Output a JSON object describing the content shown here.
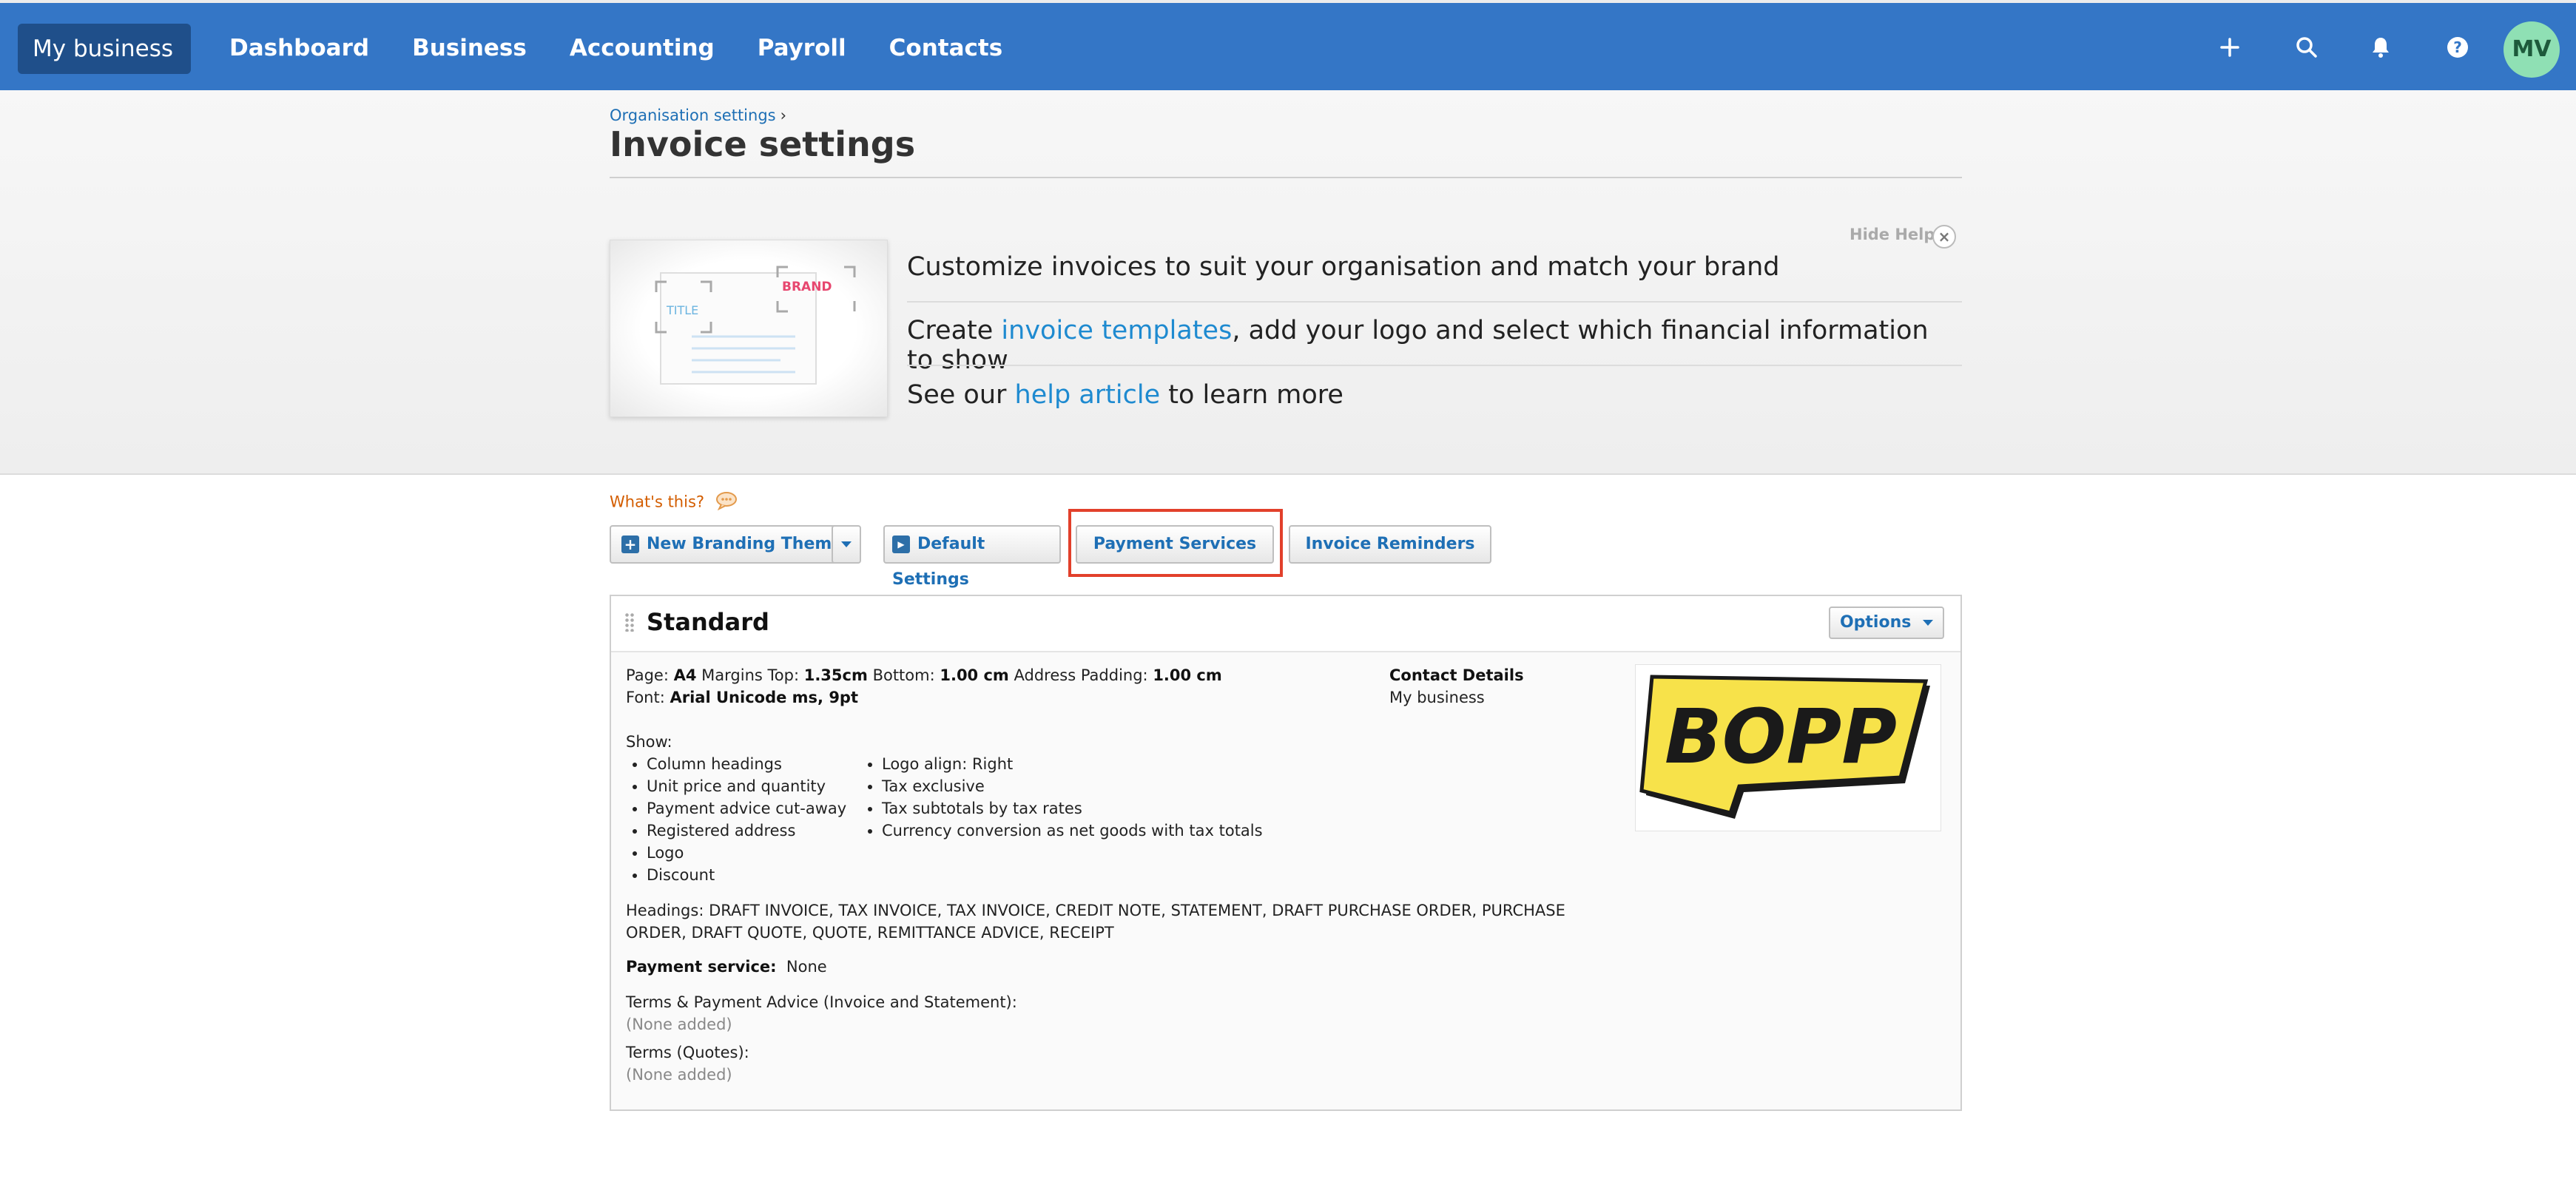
{
  "nav": {
    "business_switcher": "My business",
    "links": [
      "Dashboard",
      "Business",
      "Accounting",
      "Payroll",
      "Contacts"
    ],
    "icons": [
      "plus-icon",
      "search-icon",
      "bell-icon",
      "help-icon"
    ],
    "avatar_initials": "MV",
    "color": "#3476c6"
  },
  "breadcrumb": {
    "parent": "Organisation settings",
    "separator": "›"
  },
  "page_title": "Invoice settings",
  "help": {
    "hide_label": "Hide Help",
    "thumb_title": "TITLE",
    "thumb_brand": "BRAND",
    "line1": "Customize invoices to suit your organisation and match your brand",
    "line2_pre": "Create ",
    "line2_link": "invoice templates",
    "line2_post": ", add your logo and select which financial information to show",
    "line3_pre": "See our ",
    "line3_link": "help article",
    "line3_post": " to learn more"
  },
  "toolbar": {
    "whats_this": "What's this?",
    "new_theme": "New Branding Theme",
    "default_settings": "Default Settings",
    "payment_services": "Payment Services",
    "invoice_reminders": "Invoice Reminders"
  },
  "theme": {
    "name": "Standard",
    "options_label": "Options",
    "page_label": "Page:",
    "page_value": "A4",
    "margins_top_label": "Margins Top:",
    "margins_top_value": "1.35cm",
    "bottom_label": "Bottom:",
    "bottom_value": "1.00 cm",
    "address_padding_label": "Address Padding:",
    "address_padding_value": "1.00 cm",
    "font_label": "Font:",
    "font_value": "Arial Unicode ms, 9pt",
    "show_label": "Show:",
    "show_col1": [
      "Column headings",
      "Unit price and quantity",
      "Payment advice cut-away",
      "Registered address",
      "Logo",
      "Discount"
    ],
    "show_col2": [
      "Logo align: Right",
      "Tax exclusive",
      "Tax subtotals by tax rates",
      "Currency conversion as net goods with tax totals"
    ],
    "headings_line1": "Headings: DRAFT INVOICE, TAX INVOICE, TAX INVOICE, CREDIT NOTE, STATEMENT, DRAFT PURCHASE ORDER, PURCHASE",
    "headings_line2": "ORDER, DRAFT QUOTE, QUOTE, REMITTANCE ADVICE, RECEIPT",
    "payment_service_label": "Payment service:",
    "payment_service_value": "None",
    "terms_invoice_label": "Terms & Payment Advice (Invoice and Statement):",
    "terms_invoice_value": "(None added)",
    "terms_quotes_label": "Terms (Quotes):",
    "terms_quotes_value": "(None added)",
    "contact_details_label": "Contact Details",
    "contact_details_value": "My business",
    "logo_text": "BOPP",
    "logo_color": "#f7e24a"
  }
}
